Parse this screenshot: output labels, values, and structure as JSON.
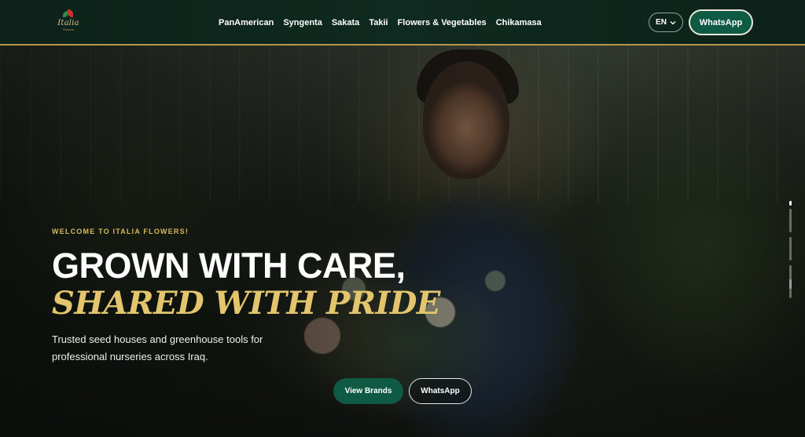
{
  "header": {
    "logo": {
      "wordmark": "Italia",
      "tagline": "Flowers"
    },
    "nav": [
      {
        "label": "PanAmerican"
      },
      {
        "label": "Syngenta"
      },
      {
        "label": "Sakata"
      },
      {
        "label": "Takii"
      },
      {
        "label": "Flowers & Vegetables"
      },
      {
        "label": "Chikamasa"
      }
    ],
    "language": {
      "label": "EN",
      "icon": "chevron-down-icon"
    },
    "whatsapp_label": "WhatsApp"
  },
  "hero": {
    "eyebrow": "WELCOME TO ITALIA FLOWERS!",
    "title_line1": "GROWN WITH CARE,",
    "title_line2": "SHARED WITH PRIDE",
    "subtitle": "Trusted seed houses and greenhouse tools for professional nurseries across Iraq.",
    "primary_cta": "View Brands",
    "secondary_cta": "WhatsApp",
    "slide_count": 5,
    "active_slide": 1
  },
  "colors": {
    "header_bg": "#0f2a20",
    "accent_gold": "#e3c56e",
    "brand_green": "#0e5a42",
    "header_border": "#b9974a"
  }
}
